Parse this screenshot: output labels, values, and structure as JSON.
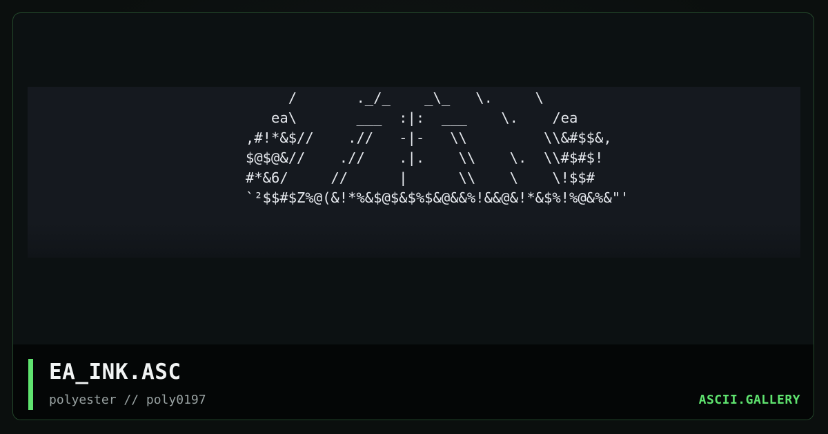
{
  "card": {
    "ascii_art": [
      "     /       ._/_    _\\_   \\.     \\",
      "   ea\\       ___  :|:  ___    \\.    /ea",
      ",#!*&$//    .//   -|-   \\\\         \\\\&#$$&,",
      "$@$@&//    .//    .|.    \\\\    \\.  \\\\#$#$!",
      "#*&6/     //      |      \\\\    \\    \\!$$#",
      "`²$$#$Z%@(&!*%&$@$&$%$&@&&%!&&@&!*&$%!%@&%&\"'"
    ],
    "title": "EA_INK.ASC",
    "subtitle": "polyester // poly0197",
    "brand": "ASCII.GALLERY"
  },
  "colors": {
    "accent": "#5fe36f",
    "border": "#24482b",
    "title": "#f2f4f4",
    "subtitle": "#9aa3a3",
    "art_text": "#e6e9ee",
    "art_background": "#15191f"
  }
}
